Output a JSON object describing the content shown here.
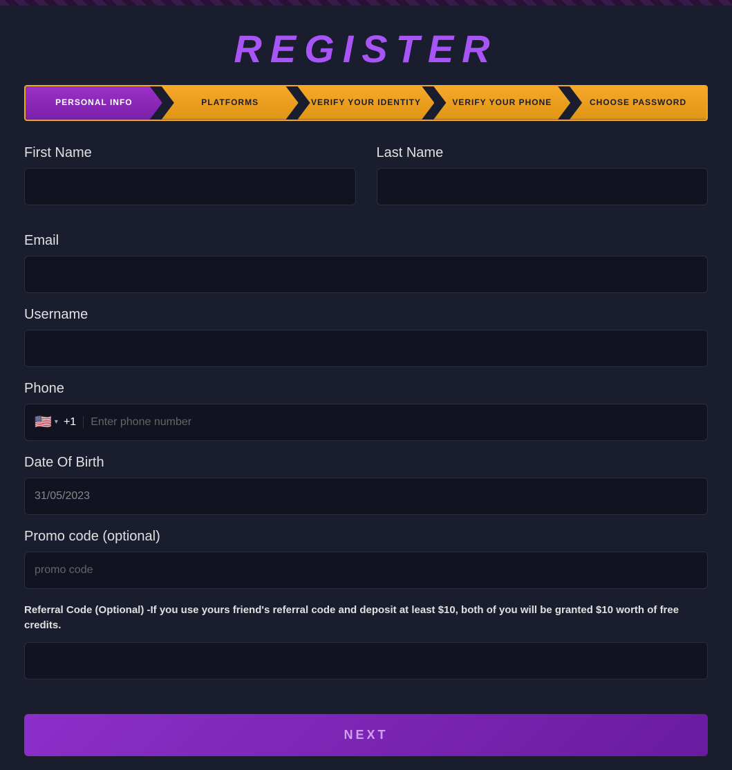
{
  "page": {
    "title": "REGISTER",
    "header_bar": true
  },
  "steps": [
    {
      "id": "personal-info",
      "label": "PERSONAL INFO",
      "active": true
    },
    {
      "id": "platforms",
      "label": "PLATFORMS",
      "active": false
    },
    {
      "id": "verify-identity",
      "label": "VERIFY YOUR IDENTITY",
      "active": false
    },
    {
      "id": "verify-phone",
      "label": "VERIFY YOUR PHONE",
      "active": false
    },
    {
      "id": "choose-password",
      "label": "CHOOSE PASSWORD",
      "active": false
    }
  ],
  "form": {
    "first_name_label": "First Name",
    "first_name_placeholder": "",
    "last_name_label": "Last Name",
    "last_name_placeholder": "",
    "email_label": "Email",
    "email_placeholder": "",
    "username_label": "Username",
    "username_placeholder": "",
    "phone_label": "Phone",
    "phone_flag": "🇺🇸",
    "phone_country_code": "+1",
    "phone_placeholder": "Enter phone number",
    "dob_label": "Date Of Birth",
    "dob_value": "31/05/2023",
    "promo_label": "Promo code (optional)",
    "promo_placeholder": "promo code",
    "referral_label": "Referral Code (Optional) -If you use yours friend's referral code and deposit at least $10, both of you will be granted $10 worth of free credits.",
    "referral_placeholder": "",
    "next_button": "NEXT"
  }
}
